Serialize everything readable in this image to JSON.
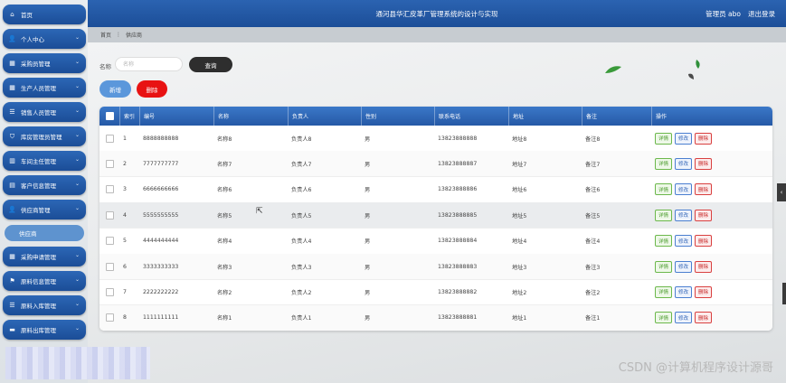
{
  "app": {
    "title": "通河县华汇皮革厂管理系统的设计与实现",
    "role": "管理员 abo",
    "logout": "退出登录"
  },
  "breadcrumb": {
    "home": "首页",
    "current": "供应商"
  },
  "sidebar": {
    "items": [
      {
        "label": "首页",
        "icon": "home-icon",
        "expandable": false
      },
      {
        "label": "个人中心",
        "icon": "person-icon",
        "expandable": true
      },
      {
        "label": "采购员管理",
        "icon": "grid-icon",
        "expandable": true
      },
      {
        "label": "生产人员管理",
        "icon": "grid-icon",
        "expandable": true
      },
      {
        "label": "销售人员管理",
        "icon": "list-icon",
        "expandable": true
      },
      {
        "label": "库房管理员管理",
        "icon": "shield-icon",
        "expandable": true
      },
      {
        "label": "车间主任管理",
        "icon": "chart-icon",
        "expandable": true
      },
      {
        "label": "客户信息管理",
        "icon": "card-icon",
        "expandable": true
      },
      {
        "label": "供应商管理",
        "icon": "person-icon",
        "expandable": true
      },
      {
        "label": "采购申请管理",
        "icon": "grid-icon",
        "expandable": true
      },
      {
        "label": "原料信息管理",
        "icon": "flag-icon",
        "expandable": true
      },
      {
        "label": "原料入库管理",
        "icon": "list-icon",
        "expandable": true
      },
      {
        "label": "原料出库管理",
        "icon": "ticket-icon",
        "expandable": true
      }
    ],
    "sub_item": "供应商"
  },
  "search": {
    "label": "名称",
    "placeholder": "名称",
    "button": "查询"
  },
  "actions": {
    "add": "新增",
    "delete": "删除"
  },
  "table": {
    "headers": [
      "索引",
      "编号",
      "名称",
      "负责人",
      "性别",
      "联系电话",
      "地址",
      "备注",
      "操作"
    ],
    "rows": [
      [
        "1",
        "8888888888",
        "名称8",
        "负责人8",
        "男",
        "13823888888",
        "地址8",
        "备注8"
      ],
      [
        "2",
        "7777777777",
        "名称7",
        "负责人7",
        "男",
        "13823888887",
        "地址7",
        "备注7"
      ],
      [
        "3",
        "6666666666",
        "名称6",
        "负责人6",
        "男",
        "13823888886",
        "地址6",
        "备注6"
      ],
      [
        "4",
        "5555555555",
        "名称5",
        "负责人5",
        "男",
        "13823888885",
        "地址5",
        "备注5"
      ],
      [
        "5",
        "4444444444",
        "名称4",
        "负责人4",
        "男",
        "13823888884",
        "地址4",
        "备注4"
      ],
      [
        "6",
        "3333333333",
        "名称3",
        "负责人3",
        "男",
        "13823888883",
        "地址3",
        "备注3"
      ],
      [
        "7",
        "2222222222",
        "名称2",
        "负责人2",
        "男",
        "13823888882",
        "地址2",
        "备注2"
      ],
      [
        "8",
        "1111111111",
        "名称1",
        "负责人1",
        "男",
        "13823888881",
        "地址1",
        "备注1"
      ]
    ],
    "row_actions": [
      "详情",
      "修改",
      "删除"
    ]
  },
  "watermark": "CSDN @计算机程序设计源哥",
  "colors": {
    "primary": "#1f56a3",
    "danger": "#e81212",
    "dark_button": "#2e2e2e",
    "add_button": "#5b97db"
  }
}
